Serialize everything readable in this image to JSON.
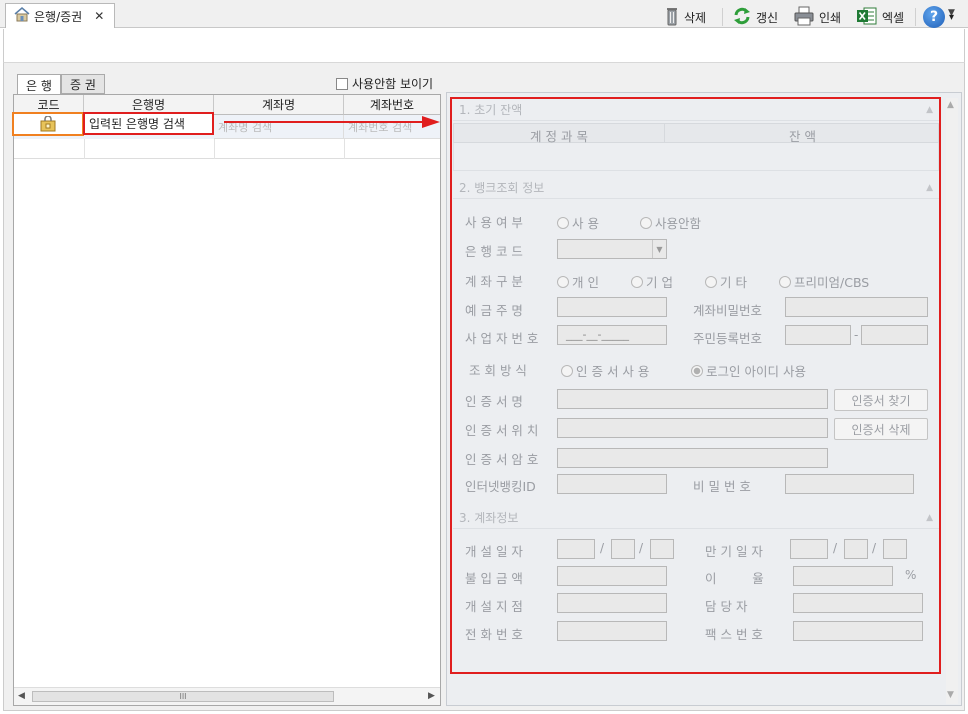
{
  "window": {
    "tab_title": "은행/증권",
    "tab_close": "✕",
    "dropdown": "▼"
  },
  "toolbar": {
    "delete": "삭제",
    "refresh": "갱신",
    "print": "인쇄",
    "excel": "엑셀",
    "help": "?",
    "help_arrow": "▾"
  },
  "left": {
    "tabs": [
      "은 행",
      "증 권"
    ],
    "show_unused": "사용안함 보이기",
    "columns": [
      "코드",
      "은행명",
      "계좌명",
      "계좌번호"
    ],
    "search_bank": "입력된 은행명 검색",
    "search_account_name": "계좌명 검색",
    "search_account_no": "계좌번호 검색",
    "scroll_left": "◀",
    "scroll_right": "▶",
    "scroll_grip": "III"
  },
  "section1": {
    "title": "1. 초기 잔액",
    "col_account": "계 정 과 목",
    "col_balance": "잔   액"
  },
  "section2": {
    "title": "2. 뱅크조회 정보",
    "use_label": "사 용 여 부",
    "use_options": [
      "사 용",
      "사용안함"
    ],
    "bank_code": "은 행 코 드",
    "account_type": "계 좌 구 분",
    "account_type_options": [
      "개 인",
      "기 업",
      "기 타",
      "프리미엄/CBS"
    ],
    "depositor": "예 금 주 명",
    "account_pw": "계좌비밀번호",
    "biz_no": "사 업 자 번 호",
    "biz_no_value": "___-__-_____",
    "resident_no": "주민등록번호",
    "resident_dash": "-",
    "query_method": "조 회 방 식",
    "query_options": [
      "인 증 서 사 용",
      "로그인 아이디 사용"
    ],
    "cert_name": "인 증 서 명",
    "cert_find": "인증서 찾기",
    "cert_location": "인 증 서 위 치",
    "cert_delete": "인증서 삭제",
    "cert_pw": "인 증 서 암 호",
    "ibank_id": "인터넷뱅킹ID",
    "password": "비 밀 번 호"
  },
  "section3": {
    "title": "3. 계좌정보",
    "open_date": "개 설 일 자",
    "maturity_date": "만 기 일 자",
    "date_sep": "/",
    "deposit_amount": "불 입 금 액",
    "interest": "이         율",
    "percent": "%",
    "branch": "개 설 지 점",
    "manager": "담 당 자",
    "phone": "전 화 번 호",
    "fax": "팩 스 번 호"
  },
  "colors": {
    "highlight": "#e01e1e",
    "selection": "#f08020"
  }
}
